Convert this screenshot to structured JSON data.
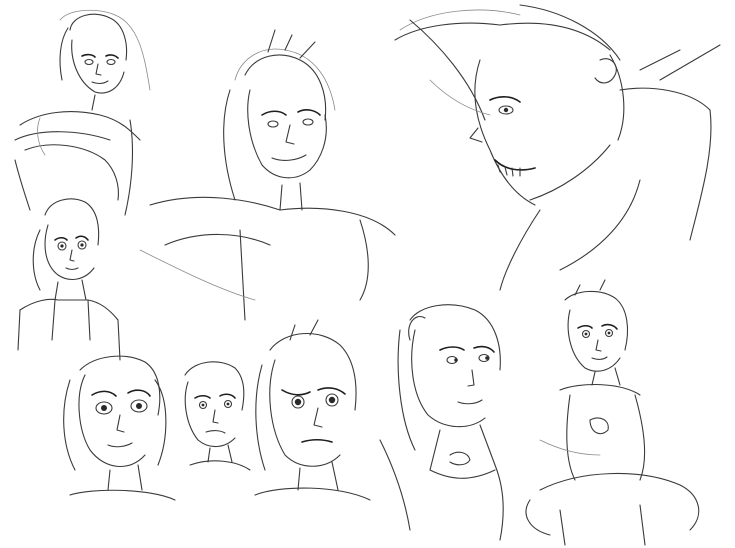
{
  "sheet": {
    "background": "#ffffff",
    "ink_color": "#3a3a3a",
    "sketch_count": 10
  }
}
